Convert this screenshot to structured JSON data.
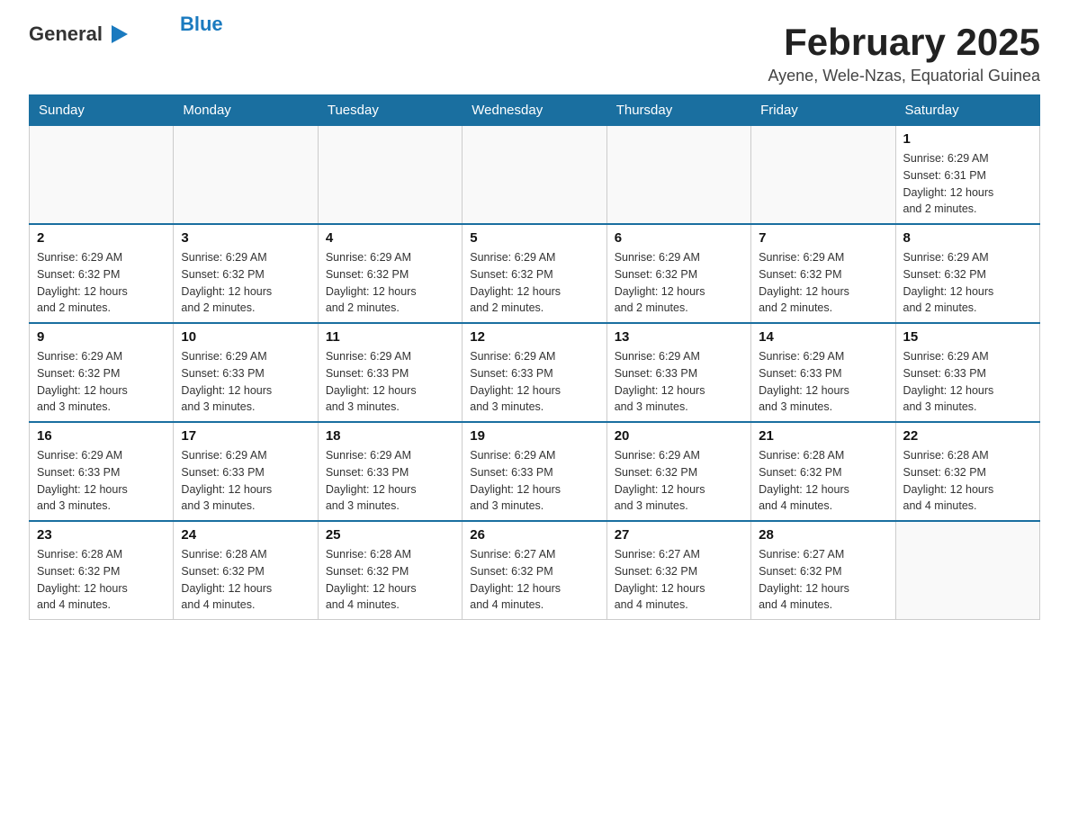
{
  "logo": {
    "general": "General",
    "blue": "Blue"
  },
  "title": "February 2025",
  "subtitle": "Ayene, Wele-Nzas, Equatorial Guinea",
  "days_of_week": [
    "Sunday",
    "Monday",
    "Tuesday",
    "Wednesday",
    "Thursday",
    "Friday",
    "Saturday"
  ],
  "weeks": [
    [
      {
        "day": "",
        "info": ""
      },
      {
        "day": "",
        "info": ""
      },
      {
        "day": "",
        "info": ""
      },
      {
        "day": "",
        "info": ""
      },
      {
        "day": "",
        "info": ""
      },
      {
        "day": "",
        "info": ""
      },
      {
        "day": "1",
        "info": "Sunrise: 6:29 AM\nSunset: 6:31 PM\nDaylight: 12 hours\nand 2 minutes."
      }
    ],
    [
      {
        "day": "2",
        "info": "Sunrise: 6:29 AM\nSunset: 6:32 PM\nDaylight: 12 hours\nand 2 minutes."
      },
      {
        "day": "3",
        "info": "Sunrise: 6:29 AM\nSunset: 6:32 PM\nDaylight: 12 hours\nand 2 minutes."
      },
      {
        "day": "4",
        "info": "Sunrise: 6:29 AM\nSunset: 6:32 PM\nDaylight: 12 hours\nand 2 minutes."
      },
      {
        "day": "5",
        "info": "Sunrise: 6:29 AM\nSunset: 6:32 PM\nDaylight: 12 hours\nand 2 minutes."
      },
      {
        "day": "6",
        "info": "Sunrise: 6:29 AM\nSunset: 6:32 PM\nDaylight: 12 hours\nand 2 minutes."
      },
      {
        "day": "7",
        "info": "Sunrise: 6:29 AM\nSunset: 6:32 PM\nDaylight: 12 hours\nand 2 minutes."
      },
      {
        "day": "8",
        "info": "Sunrise: 6:29 AM\nSunset: 6:32 PM\nDaylight: 12 hours\nand 2 minutes."
      }
    ],
    [
      {
        "day": "9",
        "info": "Sunrise: 6:29 AM\nSunset: 6:32 PM\nDaylight: 12 hours\nand 3 minutes."
      },
      {
        "day": "10",
        "info": "Sunrise: 6:29 AM\nSunset: 6:33 PM\nDaylight: 12 hours\nand 3 minutes."
      },
      {
        "day": "11",
        "info": "Sunrise: 6:29 AM\nSunset: 6:33 PM\nDaylight: 12 hours\nand 3 minutes."
      },
      {
        "day": "12",
        "info": "Sunrise: 6:29 AM\nSunset: 6:33 PM\nDaylight: 12 hours\nand 3 minutes."
      },
      {
        "day": "13",
        "info": "Sunrise: 6:29 AM\nSunset: 6:33 PM\nDaylight: 12 hours\nand 3 minutes."
      },
      {
        "day": "14",
        "info": "Sunrise: 6:29 AM\nSunset: 6:33 PM\nDaylight: 12 hours\nand 3 minutes."
      },
      {
        "day": "15",
        "info": "Sunrise: 6:29 AM\nSunset: 6:33 PM\nDaylight: 12 hours\nand 3 minutes."
      }
    ],
    [
      {
        "day": "16",
        "info": "Sunrise: 6:29 AM\nSunset: 6:33 PM\nDaylight: 12 hours\nand 3 minutes."
      },
      {
        "day": "17",
        "info": "Sunrise: 6:29 AM\nSunset: 6:33 PM\nDaylight: 12 hours\nand 3 minutes."
      },
      {
        "day": "18",
        "info": "Sunrise: 6:29 AM\nSunset: 6:33 PM\nDaylight: 12 hours\nand 3 minutes."
      },
      {
        "day": "19",
        "info": "Sunrise: 6:29 AM\nSunset: 6:33 PM\nDaylight: 12 hours\nand 3 minutes."
      },
      {
        "day": "20",
        "info": "Sunrise: 6:29 AM\nSunset: 6:32 PM\nDaylight: 12 hours\nand 3 minutes."
      },
      {
        "day": "21",
        "info": "Sunrise: 6:28 AM\nSunset: 6:32 PM\nDaylight: 12 hours\nand 4 minutes."
      },
      {
        "day": "22",
        "info": "Sunrise: 6:28 AM\nSunset: 6:32 PM\nDaylight: 12 hours\nand 4 minutes."
      }
    ],
    [
      {
        "day": "23",
        "info": "Sunrise: 6:28 AM\nSunset: 6:32 PM\nDaylight: 12 hours\nand 4 minutes."
      },
      {
        "day": "24",
        "info": "Sunrise: 6:28 AM\nSunset: 6:32 PM\nDaylight: 12 hours\nand 4 minutes."
      },
      {
        "day": "25",
        "info": "Sunrise: 6:28 AM\nSunset: 6:32 PM\nDaylight: 12 hours\nand 4 minutes."
      },
      {
        "day": "26",
        "info": "Sunrise: 6:27 AM\nSunset: 6:32 PM\nDaylight: 12 hours\nand 4 minutes."
      },
      {
        "day": "27",
        "info": "Sunrise: 6:27 AM\nSunset: 6:32 PM\nDaylight: 12 hours\nand 4 minutes."
      },
      {
        "day": "28",
        "info": "Sunrise: 6:27 AM\nSunset: 6:32 PM\nDaylight: 12 hours\nand 4 minutes."
      },
      {
        "day": "",
        "info": ""
      }
    ]
  ]
}
